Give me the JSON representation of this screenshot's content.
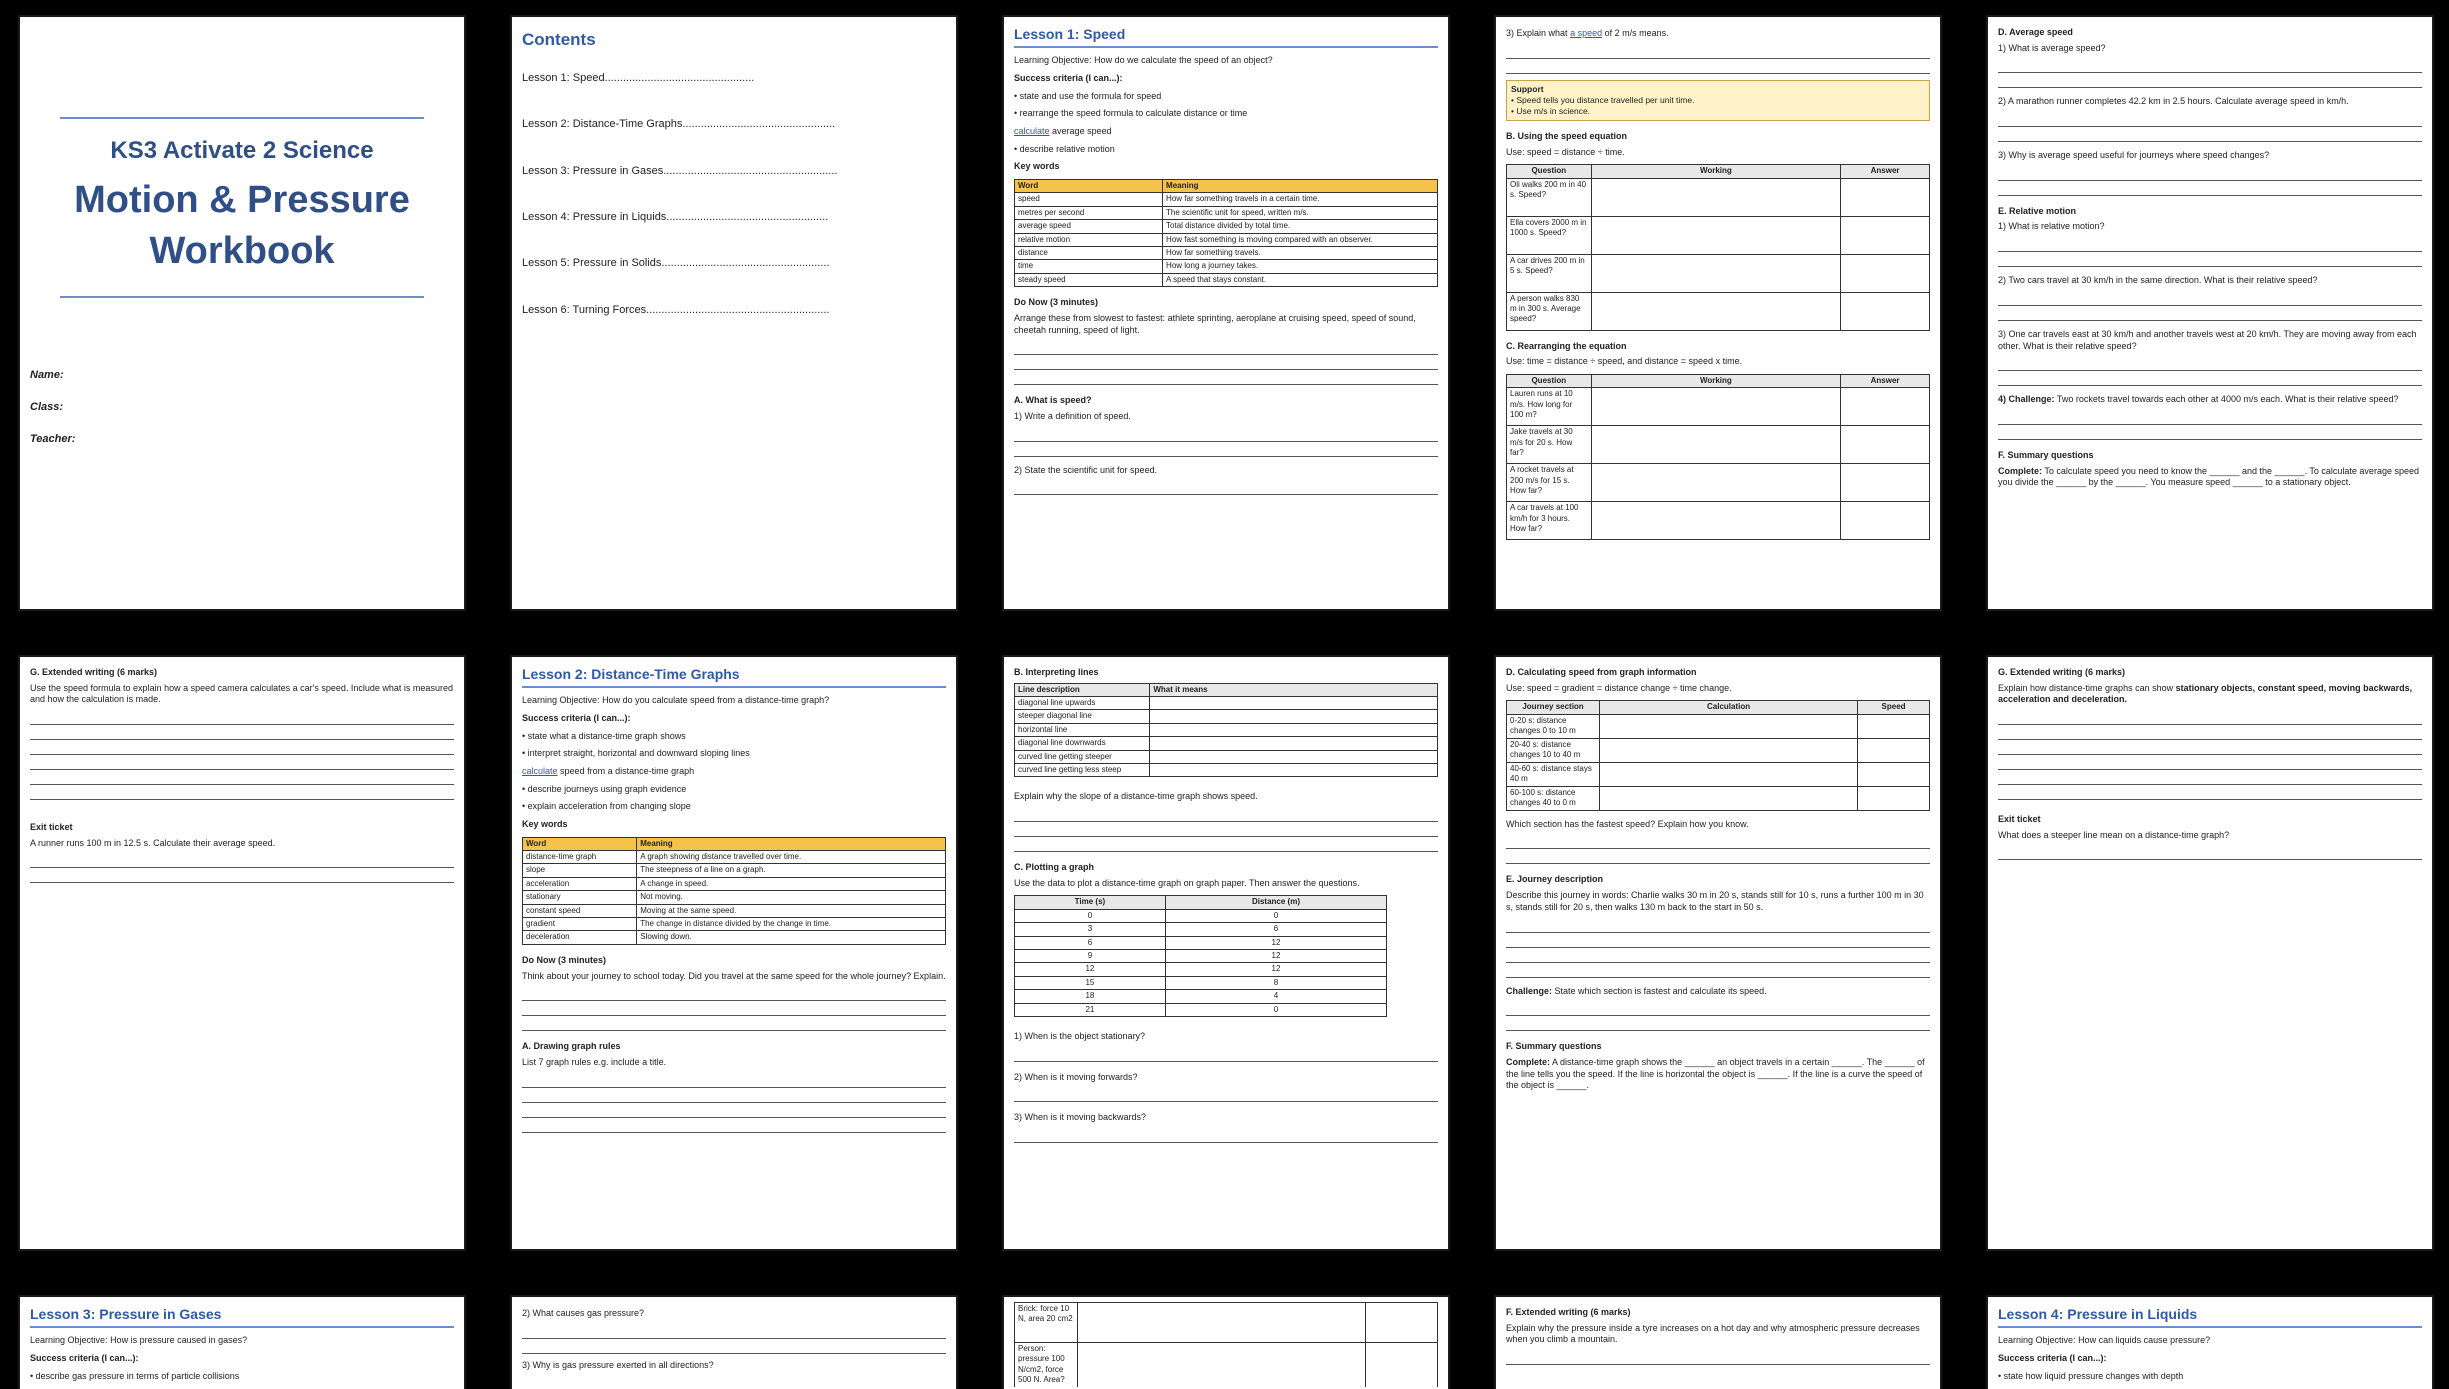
{
  "cover": {
    "subtitle": "KS3 Activate 2 Science",
    "title_line1": "Motion & Pressure",
    "title_line2": "Workbook",
    "fields": [
      "Name:",
      "Class:",
      "Teacher:"
    ]
  },
  "contents": {
    "heading": "Contents",
    "items": [
      "Lesson 1: Speed.................................................",
      "Lesson 2: Distance-Time Graphs..................................................",
      "Lesson 3: Pressure in Gases.........................................................",
      "Lesson 4: Pressure in Liquids.....................................................",
      "Lesson 5: Pressure in Solids.......................................................",
      "Lesson 6: Turning Forces............................................................"
    ]
  },
  "lesson1": {
    "title": "Lesson 1: Speed",
    "objective_label": "Learning Objective:",
    "objective": "How do we calculate the speed of an object?",
    "criteria_label": "Success criteria (I can...):",
    "criteria": [
      "state and use the formula for speed",
      "rearrange the speed formula to calculate distance or time",
      "average speed",
      "describe relative motion"
    ],
    "criteria_link": "calculate",
    "keywords_label": "Key words",
    "kw_head": [
      "Word",
      "Meaning"
    ],
    "keywords": [
      [
        "speed",
        "How far something travels in a certain time."
      ],
      [
        "metres per second",
        "The scientific unit for speed, written m/s."
      ],
      [
        "average speed",
        "Total distance divided by total time."
      ],
      [
        "relative motion",
        "How fast something is moving compared with an observer."
      ],
      [
        "distance",
        "How far something travels."
      ],
      [
        "time",
        "How long a journey takes."
      ],
      [
        "steady speed",
        "A speed that stays constant."
      ]
    ],
    "donow_label": "Do Now (3 minutes)",
    "donow": "Arrange these from slowest to fastest: athlete sprinting, aeroplane at cruising speed, speed of sound, cheetah running, speed of light.",
    "secA": "A. What is speed?",
    "q1": "1) Write a definition of speed.",
    "q2": "2) State the scientific unit for speed."
  },
  "p4": {
    "q3_pre": "3) Explain what",
    "q3_link": "a speed",
    "q3_post": "of 2 m/s means.",
    "support_label": "Support",
    "support_lines": [
      "• Speed tells you distance travelled per unit time.",
      "• Use m/s in science."
    ],
    "secB": "B. Using the speed equation",
    "useB": "Use: speed = distance ÷ time.",
    "tab_head": [
      "Question",
      "Working",
      "Answer"
    ],
    "rowsB": [
      "Oli walks 200 m in 40 s. Speed?",
      "Ella covers 2000 m in 1000 s. Speed?",
      "A car drives 200 m in 5 s. Speed?",
      "A person walks 830 m in 300 s. Average speed?"
    ],
    "secC": "C. Rearranging the equation",
    "useC": "Use: time = distance ÷ speed, and distance = speed x time.",
    "rowsC": [
      "Lauren runs at 10 m/s. How long for 100 m?",
      "Jake travels at 30 m/s for 20 s. How far?",
      "A rocket travels at 200 m/s for 15 s. How far?",
      "A car travels at 100 km/h for 3 hours. How far?"
    ]
  },
  "p5": {
    "secD": "D. Average speed",
    "q1": "1) What is average speed?",
    "q2": "2) A marathon runner completes 42.2 km in 2.5 hours. Calculate average speed in km/h.",
    "q3": "3) Why is average speed useful for journeys where speed changes?",
    "secE": "E. Relative motion",
    "e1": "1) What is relative motion?",
    "e2": "2) Two cars travel at 30 km/h in the same direction. What is their relative speed?",
    "e3": "3) One car travels east at 30 km/h and another travels west at 20 km/h. They are moving away from each other. What is their relative speed?",
    "e4_label": "4) Challenge:",
    "e4": "Two rockets travel towards each other at 4000 m/s each. What is their relative speed?",
    "secF": "F. Summary questions",
    "f_label": "Complete:",
    "f_text": "To calculate speed you need to know the ______ and the ______. To calculate average speed you divide the ______ by the ______. You measure speed ______ to a stationary object."
  },
  "p6": {
    "secG": "G. Extended writing (6 marks)",
    "g_text": "Use the speed formula to explain how a speed camera calculates a car's speed. Include what is measured and how the calculation is made.",
    "exit_label": "Exit ticket",
    "exit_text": "A runner runs 100 m in 12.5 s. Calculate their average speed."
  },
  "lesson2": {
    "title": "Lesson 2: Distance-Time Graphs",
    "objective_label": "Learning Objective:",
    "objective": "How do you calculate speed from a distance-time graph?",
    "criteria_label": "Success criteria (I can...):",
    "criteria": [
      "state what a distance-time graph shows",
      "interpret straight, horizontal and downward sloping lines",
      "speed from a distance-time graph",
      "describe journeys using graph evidence",
      "explain acceleration from changing slope"
    ],
    "criteria_link": "calculate",
    "keywords_label": "Key words",
    "kw_head": [
      "Word",
      "Meaning"
    ],
    "keywords": [
      [
        "distance-time graph",
        "A graph showing distance travelled over time."
      ],
      [
        "slope",
        "The steepness of a line on a graph."
      ],
      [
        "acceleration",
        "A change in speed."
      ],
      [
        "stationary",
        "Not moving."
      ],
      [
        "constant speed",
        "Moving at the same speed."
      ],
      [
        "gradient",
        "The change in distance divided by the change in time."
      ],
      [
        "deceleration",
        "Slowing down."
      ]
    ],
    "donow_label": "Do Now (3 minutes)",
    "donow": "Think about your journey to school today. Did you travel at the same speed for the whole journey? Explain.",
    "secA": "A. Drawing graph rules",
    "a_text": "List 7 graph rules e.g. include a title."
  },
  "p8": {
    "secB": "B. Interpreting lines",
    "tab_head": [
      "Line description",
      "What it means"
    ],
    "lines": [
      "diagonal line upwards",
      "steeper diagonal line",
      "horizontal line",
      "diagonal line downwards",
      "curved line getting steeper",
      "curved line getting less steep"
    ],
    "explain": "Explain why the slope of a distance-time graph shows speed.",
    "secC": "C. Plotting a graph",
    "useC": "Use the data to plot a distance-time graph on graph paper. Then answer the questions.",
    "plot_head": [
      "Time (s)",
      "Distance (m)"
    ],
    "plot_rows": [
      [
        "0",
        "0"
      ],
      [
        "3",
        "6"
      ],
      [
        "6",
        "12"
      ],
      [
        "9",
        "12"
      ],
      [
        "12",
        "12"
      ],
      [
        "15",
        "8"
      ],
      [
        "18",
        "4"
      ],
      [
        "21",
        "0"
      ]
    ],
    "q1": "1) When is the object stationary?",
    "q2": "2) When is it moving forwards?",
    "q3": "3) When is it moving backwards?"
  },
  "p9": {
    "secD": "D. Calculating speed from graph information",
    "useD": "Use: speed = gradient = distance change ÷ time change.",
    "tab_head": [
      "Journey section",
      "Calculation",
      "Speed"
    ],
    "rows": [
      "0-20 s: distance changes 0 to 10 m",
      "20-40 s: distance changes 10 to 40 m",
      "40-60 s: distance stays 40 m",
      "60-100 s: distance changes 40 to 0 m"
    ],
    "d_q": "Which section has the fastest speed? Explain how you know.",
    "secE": "E. Journey description",
    "e_text": "Describe this journey in words: Charlie walks 30 m in 20 s, stands still for 10 s, runs a further 100 m in 30 s, stands still for 20 s, then walks 130 m back to the start in 50 s.",
    "challenge_label": "Challenge:",
    "challenge": "State which section is fastest and calculate its speed.",
    "secF": "F. Summary questions",
    "f_label": "Complete:",
    "f_text": "A distance-time graph shows the ______ an object travels in a certain ______. The ______ of the line tells you the speed. If the line is horizontal the object is ______. If the line is a curve the speed of the object is ______."
  },
  "p10": {
    "secG": "G. Extended writing (6 marks)",
    "g_pre": "Explain how distance-time graphs can show",
    "g_bold": "stationary objects, constant speed, moving backwards, acceleration and deceleration.",
    "exit_label": "Exit ticket",
    "exit_text": "What does a steeper line mean on a distance-time graph?"
  },
  "lesson3": {
    "title": "Lesson 3: Pressure in Gases",
    "objective_label": "Learning Objective:",
    "objective": "How is pressure caused in gases?",
    "criteria_label": "Success criteria (I can...):",
    "c1": "describe gas pressure in terms of particle collisions"
  },
  "p12": {
    "q2": "2) What causes gas pressure?",
    "q3": "3) Why is gas pressure exerted in all directions?"
  },
  "p13": {
    "rows": [
      "Brick: force 10 N, area 20 cm2",
      "Person: pressure 100 N/cm2, force 500 N. Area?"
    ]
  },
  "p14": {
    "secF": "F. Extended writing (6 marks)",
    "text": "Explain why the pressure inside a tyre increases on a hot day and why atmospheric pressure decreases when you climb a mountain."
  },
  "lesson4": {
    "title": "Lesson 4: Pressure in Liquids",
    "objective_label": "Learning Objective:",
    "objective": "How can liquids cause pressure?",
    "criteria_label": "Success criteria (I can...):",
    "c1": "state how liquid pressure changes with depth"
  }
}
